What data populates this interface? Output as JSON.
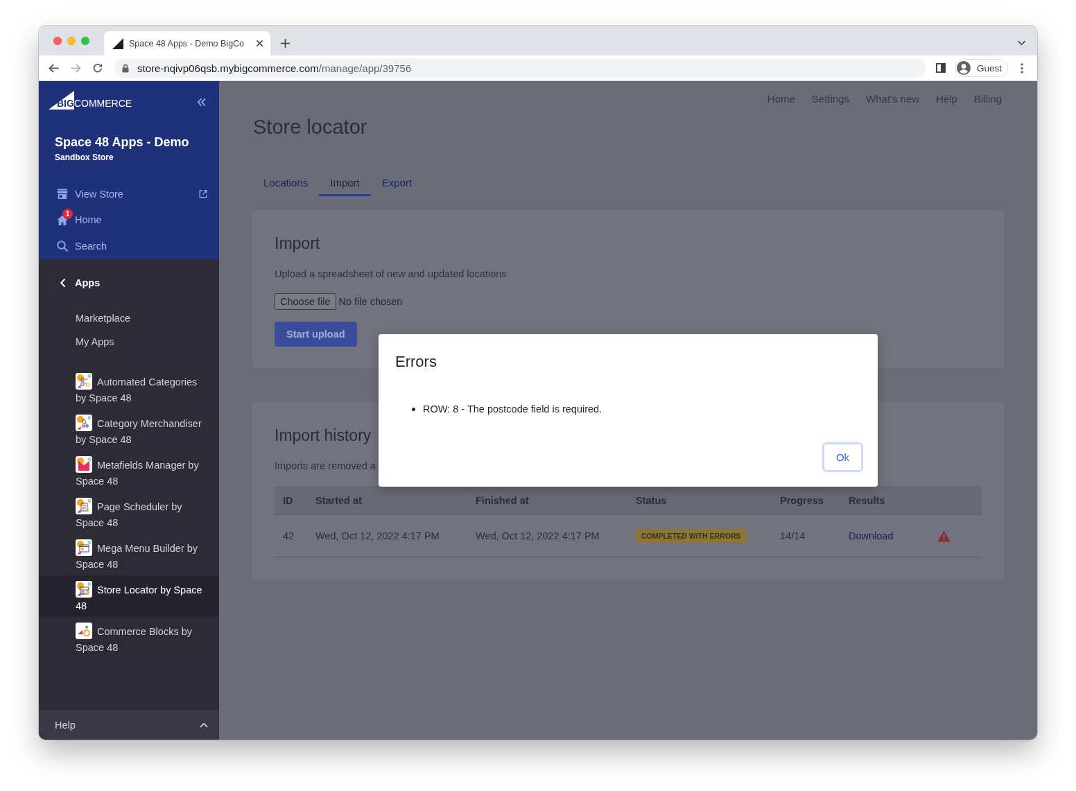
{
  "browser": {
    "tab": {
      "title": "Space 48 Apps - Demo BigCo",
      "selected": true
    },
    "address": {
      "host": "store-nqivp06qsb.mybigcommerce.com",
      "path": "/manage/app/39756"
    },
    "profile": "Guest"
  },
  "sidebar": {
    "logo": {
      "mark": "BIG",
      "word": "COMMERCE"
    },
    "store_name": "Space 48 Apps - Demo",
    "store_type": "Sandbox Store",
    "nav": [
      {
        "label": "View Store",
        "external": true
      },
      {
        "label": "Home",
        "badge": "1",
        "external": false
      },
      {
        "label": "Search",
        "external": false
      }
    ],
    "section": "Apps",
    "links": [
      "Marketplace",
      "My Apps"
    ],
    "apps": [
      {
        "label": "Automated Categories by Space 48",
        "selected": false
      },
      {
        "label": "Category Merchandiser by Space 48",
        "selected": false
      },
      {
        "label": "Metafields Manager by Space 48",
        "selected": false
      },
      {
        "label": "Page Scheduler by Space 48",
        "selected": false
      },
      {
        "label": "Mega Menu Builder by Space 48",
        "selected": false
      },
      {
        "label": "Store Locator by Space 48",
        "selected": true
      },
      {
        "label": "Commerce Blocks by Space 48",
        "selected": false
      }
    ],
    "footer": "Help"
  },
  "header_nav": [
    "Home",
    "Settings",
    "What's new",
    "Help",
    "Billing"
  ],
  "page_title": "Store locator",
  "tabs": [
    {
      "label": "Locations",
      "selected": false
    },
    {
      "label": "Import",
      "selected": true
    },
    {
      "label": "Export",
      "selected": false
    }
  ],
  "import_card": {
    "title": "Import",
    "description": "Upload a spreadsheet of new and updated locations",
    "file_button": "Choose file",
    "file_status": "No file chosen",
    "submit": "Start upload"
  },
  "history_card": {
    "title": "Import history",
    "note": "Imports are removed a",
    "table": {
      "columns": [
        "ID",
        "Started at",
        "Finished at",
        "Status",
        "Progress",
        "Results"
      ],
      "rows": [
        {
          "id": "42",
          "started_at": "Wed, Oct 12, 2022 4:17 PM",
          "finished_at": "Wed, Oct 12, 2022 4:17 PM",
          "status": "COMPLETED WITH ERRORS",
          "progress": "14/14",
          "result": "Download",
          "has_errors": true
        }
      ]
    }
  },
  "dialog": {
    "title": "Errors",
    "errors": [
      "ROW: 8 - The postcode field is required."
    ],
    "button": {
      "label": "Ok",
      "focused": true
    }
  }
}
